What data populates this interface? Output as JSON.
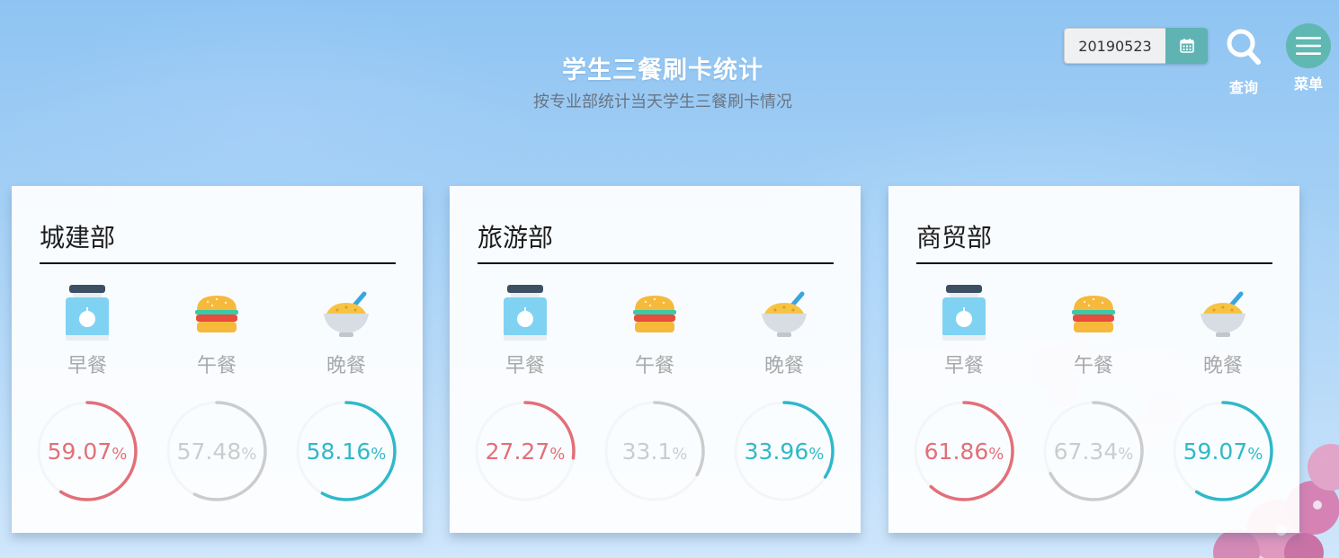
{
  "header": {
    "title": "学生三餐刷卡统计",
    "subtitle": "按专业部统计当天学生三餐刷卡情况"
  },
  "toolbar": {
    "date_value": "20190523",
    "calendar_icon": "calendar-icon",
    "search_icon": "search-icon",
    "search_label": "查询",
    "menu_icon": "hamburger-menu-icon",
    "menu_label": "菜单"
  },
  "colors": {
    "breakfast": "#e36f78",
    "lunch": "#cccccc",
    "dinner": "#2fb9c9",
    "accent": "#5fb3b3"
  },
  "meal_labels": {
    "breakfast": "早餐",
    "lunch": "午餐",
    "dinner": "晚餐"
  },
  "departments": [
    {
      "name": "城建部",
      "breakfast": {
        "value": "59.07",
        "percent": 59.07
      },
      "lunch": {
        "value": "57.48",
        "percent": 57.48
      },
      "dinner": {
        "value": "58.16",
        "percent": 58.16
      }
    },
    {
      "name": "旅游部",
      "breakfast": {
        "value": "27.27",
        "percent": 27.27
      },
      "lunch": {
        "value": "33.1",
        "percent": 33.1
      },
      "dinner": {
        "value": "33.96",
        "percent": 33.96
      }
    },
    {
      "name": "商贸部",
      "breakfast": {
        "value": "61.86",
        "percent": 61.86
      },
      "lunch": {
        "value": "67.34",
        "percent": 67.34
      },
      "dinner": {
        "value": "59.07",
        "percent": 59.07
      }
    }
  ],
  "percent_sign": "%"
}
